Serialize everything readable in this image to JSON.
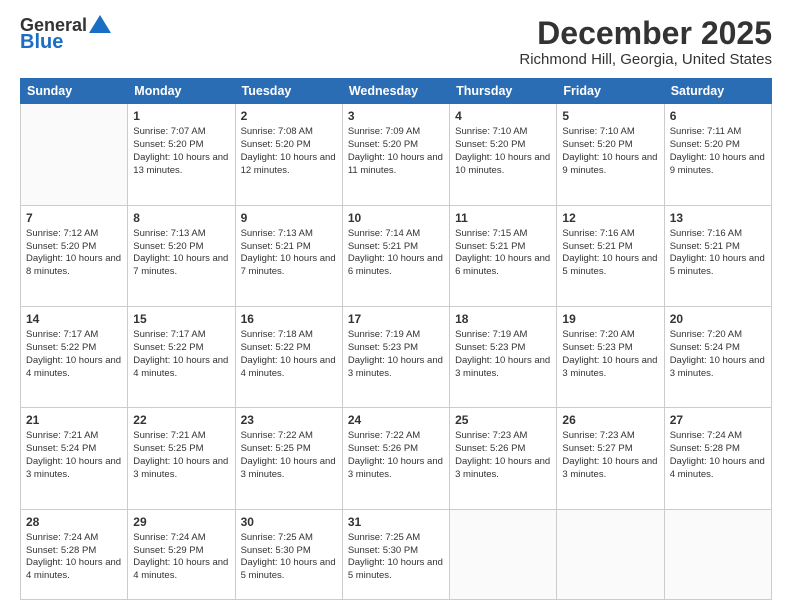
{
  "header": {
    "logo_general": "General",
    "logo_blue": "Blue",
    "title": "December 2025",
    "location": "Richmond Hill, Georgia, United States"
  },
  "days_of_week": [
    "Sunday",
    "Monday",
    "Tuesday",
    "Wednesday",
    "Thursday",
    "Friday",
    "Saturday"
  ],
  "weeks": [
    [
      {
        "day": "",
        "sunrise": "",
        "sunset": "",
        "daylight": ""
      },
      {
        "day": "1",
        "sunrise": "Sunrise: 7:07 AM",
        "sunset": "Sunset: 5:20 PM",
        "daylight": "Daylight: 10 hours and 13 minutes."
      },
      {
        "day": "2",
        "sunrise": "Sunrise: 7:08 AM",
        "sunset": "Sunset: 5:20 PM",
        "daylight": "Daylight: 10 hours and 12 minutes."
      },
      {
        "day": "3",
        "sunrise": "Sunrise: 7:09 AM",
        "sunset": "Sunset: 5:20 PM",
        "daylight": "Daylight: 10 hours and 11 minutes."
      },
      {
        "day": "4",
        "sunrise": "Sunrise: 7:10 AM",
        "sunset": "Sunset: 5:20 PM",
        "daylight": "Daylight: 10 hours and 10 minutes."
      },
      {
        "day": "5",
        "sunrise": "Sunrise: 7:10 AM",
        "sunset": "Sunset: 5:20 PM",
        "daylight": "Daylight: 10 hours and 9 minutes."
      },
      {
        "day": "6",
        "sunrise": "Sunrise: 7:11 AM",
        "sunset": "Sunset: 5:20 PM",
        "daylight": "Daylight: 10 hours and 9 minutes."
      }
    ],
    [
      {
        "day": "7",
        "sunrise": "Sunrise: 7:12 AM",
        "sunset": "Sunset: 5:20 PM",
        "daylight": "Daylight: 10 hours and 8 minutes."
      },
      {
        "day": "8",
        "sunrise": "Sunrise: 7:13 AM",
        "sunset": "Sunset: 5:20 PM",
        "daylight": "Daylight: 10 hours and 7 minutes."
      },
      {
        "day": "9",
        "sunrise": "Sunrise: 7:13 AM",
        "sunset": "Sunset: 5:21 PM",
        "daylight": "Daylight: 10 hours and 7 minutes."
      },
      {
        "day": "10",
        "sunrise": "Sunrise: 7:14 AM",
        "sunset": "Sunset: 5:21 PM",
        "daylight": "Daylight: 10 hours and 6 minutes."
      },
      {
        "day": "11",
        "sunrise": "Sunrise: 7:15 AM",
        "sunset": "Sunset: 5:21 PM",
        "daylight": "Daylight: 10 hours and 6 minutes."
      },
      {
        "day": "12",
        "sunrise": "Sunrise: 7:16 AM",
        "sunset": "Sunset: 5:21 PM",
        "daylight": "Daylight: 10 hours and 5 minutes."
      },
      {
        "day": "13",
        "sunrise": "Sunrise: 7:16 AM",
        "sunset": "Sunset: 5:21 PM",
        "daylight": "Daylight: 10 hours and 5 minutes."
      }
    ],
    [
      {
        "day": "14",
        "sunrise": "Sunrise: 7:17 AM",
        "sunset": "Sunset: 5:22 PM",
        "daylight": "Daylight: 10 hours and 4 minutes."
      },
      {
        "day": "15",
        "sunrise": "Sunrise: 7:17 AM",
        "sunset": "Sunset: 5:22 PM",
        "daylight": "Daylight: 10 hours and 4 minutes."
      },
      {
        "day": "16",
        "sunrise": "Sunrise: 7:18 AM",
        "sunset": "Sunset: 5:22 PM",
        "daylight": "Daylight: 10 hours and 4 minutes."
      },
      {
        "day": "17",
        "sunrise": "Sunrise: 7:19 AM",
        "sunset": "Sunset: 5:23 PM",
        "daylight": "Daylight: 10 hours and 3 minutes."
      },
      {
        "day": "18",
        "sunrise": "Sunrise: 7:19 AM",
        "sunset": "Sunset: 5:23 PM",
        "daylight": "Daylight: 10 hours and 3 minutes."
      },
      {
        "day": "19",
        "sunrise": "Sunrise: 7:20 AM",
        "sunset": "Sunset: 5:23 PM",
        "daylight": "Daylight: 10 hours and 3 minutes."
      },
      {
        "day": "20",
        "sunrise": "Sunrise: 7:20 AM",
        "sunset": "Sunset: 5:24 PM",
        "daylight": "Daylight: 10 hours and 3 minutes."
      }
    ],
    [
      {
        "day": "21",
        "sunrise": "Sunrise: 7:21 AM",
        "sunset": "Sunset: 5:24 PM",
        "daylight": "Daylight: 10 hours and 3 minutes."
      },
      {
        "day": "22",
        "sunrise": "Sunrise: 7:21 AM",
        "sunset": "Sunset: 5:25 PM",
        "daylight": "Daylight: 10 hours and 3 minutes."
      },
      {
        "day": "23",
        "sunrise": "Sunrise: 7:22 AM",
        "sunset": "Sunset: 5:25 PM",
        "daylight": "Daylight: 10 hours and 3 minutes."
      },
      {
        "day": "24",
        "sunrise": "Sunrise: 7:22 AM",
        "sunset": "Sunset: 5:26 PM",
        "daylight": "Daylight: 10 hours and 3 minutes."
      },
      {
        "day": "25",
        "sunrise": "Sunrise: 7:23 AM",
        "sunset": "Sunset: 5:26 PM",
        "daylight": "Daylight: 10 hours and 3 minutes."
      },
      {
        "day": "26",
        "sunrise": "Sunrise: 7:23 AM",
        "sunset": "Sunset: 5:27 PM",
        "daylight": "Daylight: 10 hours and 3 minutes."
      },
      {
        "day": "27",
        "sunrise": "Sunrise: 7:24 AM",
        "sunset": "Sunset: 5:28 PM",
        "daylight": "Daylight: 10 hours and 4 minutes."
      }
    ],
    [
      {
        "day": "28",
        "sunrise": "Sunrise: 7:24 AM",
        "sunset": "Sunset: 5:28 PM",
        "daylight": "Daylight: 10 hours and 4 minutes."
      },
      {
        "day": "29",
        "sunrise": "Sunrise: 7:24 AM",
        "sunset": "Sunset: 5:29 PM",
        "daylight": "Daylight: 10 hours and 4 minutes."
      },
      {
        "day": "30",
        "sunrise": "Sunrise: 7:25 AM",
        "sunset": "Sunset: 5:30 PM",
        "daylight": "Daylight: 10 hours and 5 minutes."
      },
      {
        "day": "31",
        "sunrise": "Sunrise: 7:25 AM",
        "sunset": "Sunset: 5:30 PM",
        "daylight": "Daylight: 10 hours and 5 minutes."
      },
      {
        "day": "",
        "sunrise": "",
        "sunset": "",
        "daylight": ""
      },
      {
        "day": "",
        "sunrise": "",
        "sunset": "",
        "daylight": ""
      },
      {
        "day": "",
        "sunrise": "",
        "sunset": "",
        "daylight": ""
      }
    ]
  ]
}
